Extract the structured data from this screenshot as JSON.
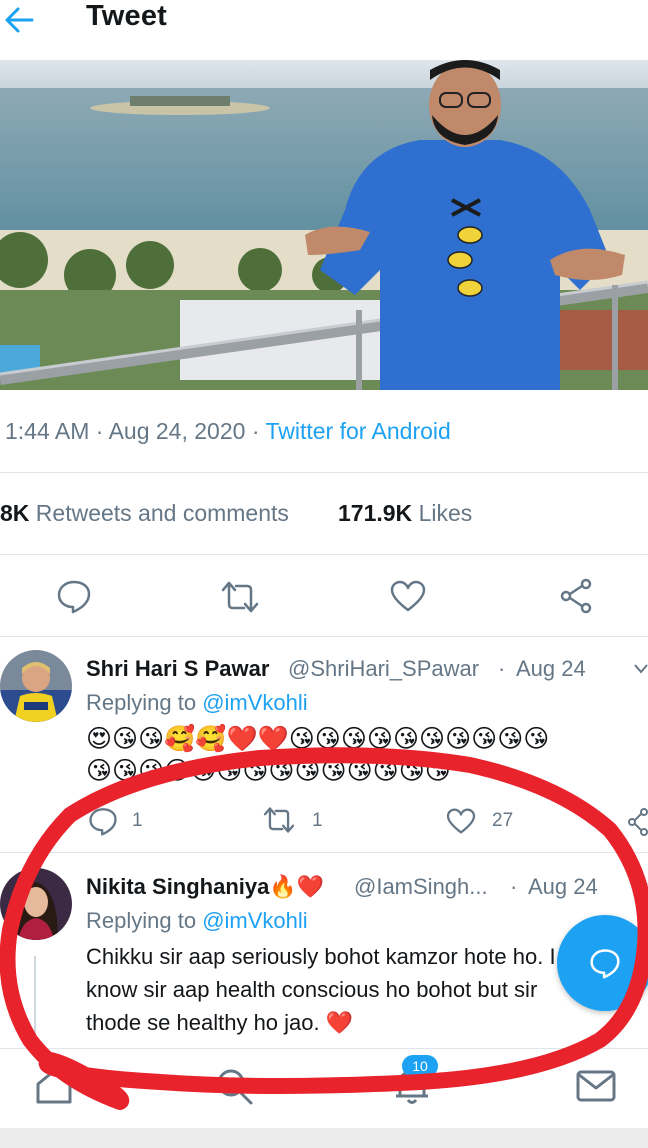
{
  "header": {
    "title": "Tweet"
  },
  "tweet": {
    "time": "1:44 AM",
    "date": "Aug 24, 2020",
    "separator": "·",
    "source": "Twitter for Android",
    "retweets_count": "8K",
    "retweets_label": "Retweets and comments",
    "likes_count": "171.9K",
    "likes_label": "Likes"
  },
  "replies": [
    {
      "name": "Shri Hari S Pawar",
      "handle": "@ShriHari_SPawar",
      "date": "Aug 24",
      "replying_label": "Replying to",
      "mention": "@imVkohli",
      "emoji_line1": "😍😘😘🥰🥰❤️❤️😘😘😘😘😘😘😘😘😘😘",
      "emoji_line2": "😘😘😘😘😘😘😘😘😘😘😘😘😘😘",
      "reply_count": "1",
      "retweet_count": "1",
      "like_count": "27"
    },
    {
      "name": "Nikita Singhaniya🔥❤️",
      "handle": "@IamSingh...",
      "date": "Aug 24",
      "replying_label": "Replying to",
      "mention": "@imVkohli",
      "text": "Chikku sir aap seriously bohot kamzor hote ho. I know sir aap health conscious ho bohot but sir thode se healthy ho jao. ❤️"
    }
  ],
  "nav": {
    "notification_badge": "10"
  },
  "colors": {
    "accent": "#1da1f2",
    "annotation": "#e8232c",
    "muted": "#657786"
  }
}
